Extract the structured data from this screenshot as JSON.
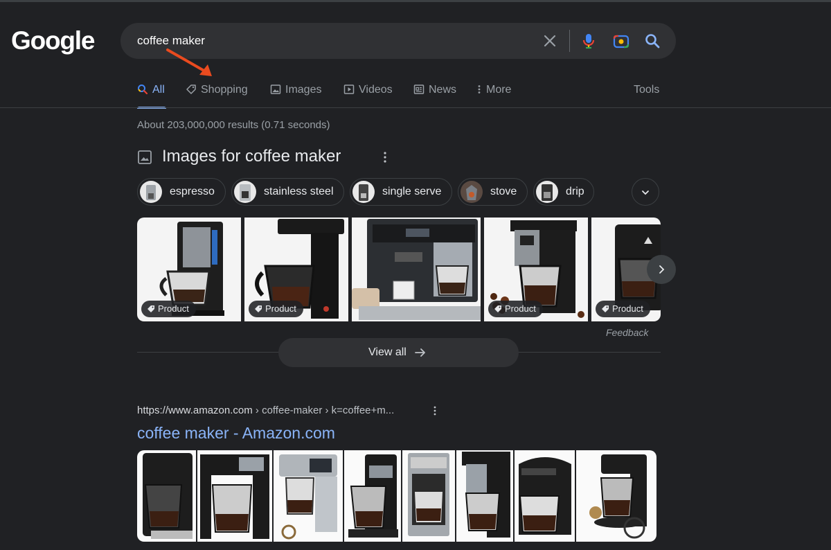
{
  "logo": "Google",
  "search": {
    "query": "coffee maker"
  },
  "tabs": [
    {
      "label": "All",
      "icon": "search-icon"
    },
    {
      "label": "Shopping",
      "icon": "tag-icon"
    },
    {
      "label": "Images",
      "icon": "image-icon"
    },
    {
      "label": "Videos",
      "icon": "play-icon"
    },
    {
      "label": "News",
      "icon": "news-icon"
    },
    {
      "label": "More",
      "icon": "more-vert-icon"
    }
  ],
  "tools_label": "Tools",
  "results_stats": "About 203,000,000 results (0.71 seconds)",
  "images_section": {
    "title": "Images for coffee maker",
    "chips": [
      "espresso",
      "stainless steel",
      "single serve",
      "stove",
      "drip"
    ],
    "badge_label": "Product",
    "feedback": "Feedback",
    "view_all": "View all"
  },
  "result": {
    "url_domain": "https://www.amazon.com",
    "url_path": " › coffee-maker › k=coffee+m...",
    "title": "coffee maker - Amazon.com"
  },
  "colors": {
    "background": "#202124",
    "link": "#8ab4f8",
    "annotation_arrow": "#ea4b1f"
  }
}
